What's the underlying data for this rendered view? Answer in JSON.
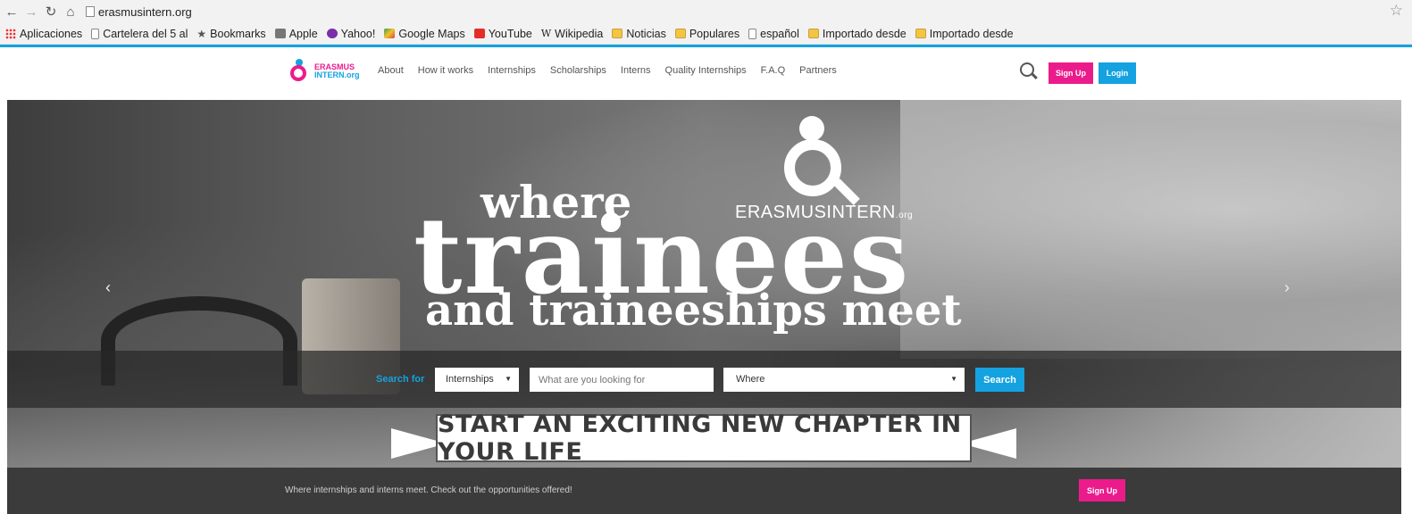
{
  "browser": {
    "url": "erasmusintern.org",
    "bookmarks": [
      {
        "label": "Aplicaciones",
        "icon": "apps-grid-icon"
      },
      {
        "label": "Cartelera del 5 al",
        "icon": "page-icon"
      },
      {
        "label": "Bookmarks",
        "icon": "star-icon"
      },
      {
        "label": "Apple",
        "icon": "apple-icon"
      },
      {
        "label": "Yahoo!",
        "icon": "yahoo-icon"
      },
      {
        "label": "Google Maps",
        "icon": "maps-icon"
      },
      {
        "label": "YouTube",
        "icon": "youtube-icon"
      },
      {
        "label": "Wikipedia",
        "icon": "wikipedia-icon"
      },
      {
        "label": "Noticias",
        "icon": "folder-icon"
      },
      {
        "label": "Populares",
        "icon": "folder-icon"
      },
      {
        "label": "español",
        "icon": "page-icon"
      },
      {
        "label": "Importado desde",
        "icon": "folder-icon"
      },
      {
        "label": "Importado desde",
        "icon": "folder-icon"
      }
    ]
  },
  "header": {
    "logo_line1": "ERASMUS",
    "logo_line2": "INTERN.org",
    "menu": [
      "About",
      "How it works",
      "Internships",
      "Scholarships",
      "Interns",
      "Quality Internships",
      "F.A.Q",
      "Partners"
    ],
    "signup_label": "Sign Up",
    "login_label": "Login"
  },
  "hero": {
    "line1": "where",
    "line2": "trainees",
    "line3": "and traineeships meet",
    "brand": "ERASMUSINTERN",
    "brand_suffix": ".org",
    "arrow_left": "‹",
    "arrow_right": "›"
  },
  "search": {
    "label": "Search for",
    "type_value": "Internships",
    "query_placeholder": "What are you looking for",
    "where_value": "Where",
    "button_label": "Search"
  },
  "banner": {
    "text": "START AN EXCITING NEW CHAPTER IN YOUR LIFE"
  },
  "footer": {
    "text": "Where internships and interns meet. Check out the opportunities offered!",
    "signup_label": "Sign Up"
  },
  "colors": {
    "accent_blue": "#14a2e0",
    "accent_pink": "#ec1b8c"
  }
}
